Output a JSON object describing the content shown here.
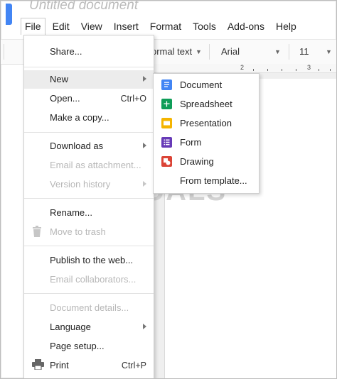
{
  "window": {
    "doc_title": "Untitled document"
  },
  "menubar": [
    "File",
    "Edit",
    "View",
    "Insert",
    "Format",
    "Tools",
    "Add-ons",
    "Help"
  ],
  "toolbar": {
    "style": "ormal text",
    "font": "Arial",
    "size": "11"
  },
  "ruler": {
    "marks": [
      "2",
      "3"
    ]
  },
  "file_menu": {
    "share": "Share...",
    "new": "New",
    "open": "Open...",
    "open_shortcut": "Ctrl+O",
    "copy": "Make a copy...",
    "download": "Download as",
    "email_attachment": "Email as attachment...",
    "version_history": "Version history",
    "rename": "Rename...",
    "trash": "Move to trash",
    "publish": "Publish to the web...",
    "email_collab": "Email collaborators...",
    "details": "Document details...",
    "language": "Language",
    "page_setup": "Page setup...",
    "print": "Print",
    "print_shortcut": "Ctrl+P"
  },
  "new_submenu": {
    "document": "Document",
    "spreadsheet": "Spreadsheet",
    "presentation": "Presentation",
    "form": "Form",
    "drawing": "Drawing",
    "template": "From template..."
  },
  "colors": {
    "document": "#4285f4",
    "spreadsheet": "#0f9d58",
    "presentation": "#f4b400",
    "form": "#673ab7",
    "drawing": "#db4437",
    "hover": "#ececec"
  },
  "watermark": "A PUALS"
}
